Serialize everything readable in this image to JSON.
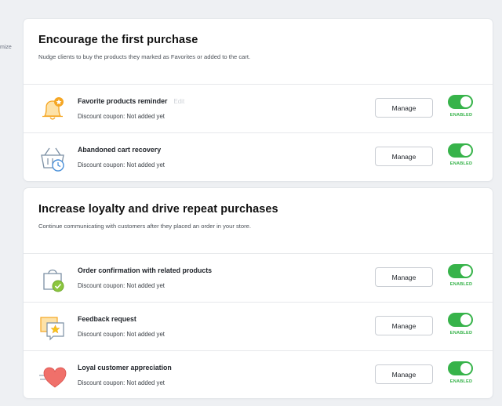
{
  "side_fragment": "mize",
  "sections": [
    {
      "title": "Encourage the first purchase",
      "description": "Nudge clients to buy the products they marked as Favorites or added to the cart.",
      "rows": [
        {
          "title": "Favorite products reminder",
          "edit": "Edit",
          "subtitle": "Discount coupon: Not added yet",
          "button": "Manage",
          "state": "ENABLED",
          "icon": "bell-star-icon"
        },
        {
          "title": "Abandoned cart recovery",
          "subtitle": "Discount coupon: Not added yet",
          "button": "Manage",
          "state": "ENABLED",
          "icon": "basket-clock-icon"
        }
      ]
    },
    {
      "title": "Increase loyalty and drive repeat purchases",
      "description": "Continue communicating with customers after they placed an order in your store.",
      "rows": [
        {
          "title": "Order confirmation with related products",
          "subtitle": "Discount coupon: Not added yet",
          "button": "Manage",
          "state": "ENABLED",
          "icon": "bag-check-icon"
        },
        {
          "title": "Feedback request",
          "subtitle": "Discount coupon: Not added yet",
          "button": "Manage",
          "state": "ENABLED",
          "icon": "feedback-star-icon"
        },
        {
          "title": "Loyal customer appreciation",
          "subtitle": "Discount coupon: Not added yet",
          "button": "Manage",
          "state": "ENABLED",
          "icon": "heart-icon"
        }
      ]
    }
  ],
  "colors": {
    "toggle_on": "#37b34a",
    "icon_orange": "#f5a623",
    "icon_green": "#8cc63f",
    "icon_red": "#f0706a"
  }
}
